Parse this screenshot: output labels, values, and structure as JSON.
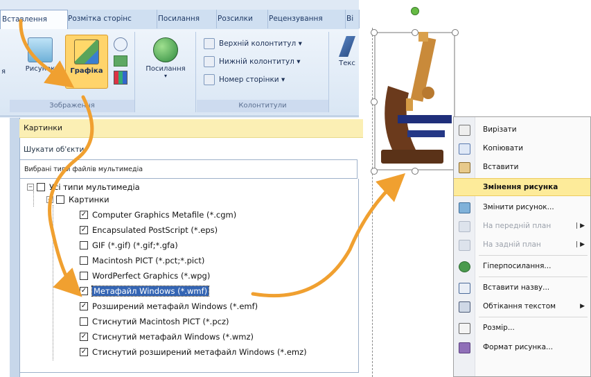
{
  "ribbon": {
    "tabs": [
      "Вставлення",
      "Розмітка сторінс",
      "Посилання",
      "Розсилки",
      "Рецензування",
      "Ві"
    ],
    "active_tab": 0,
    "left_cut_label": "я",
    "illustrations": {
      "picture": "Рисунок",
      "graphics": "Графіка",
      "group_label": "Зображення"
    },
    "links": {
      "button": "Посилання"
    },
    "headers": {
      "header": "Верхній колонтитул",
      "footer": "Нижній колонтитул",
      "page_number": "Номер сторінки",
      "group_label": "Колонтитули"
    },
    "text_cut_label": "Текс"
  },
  "clipart_pane": {
    "title": "Картинки",
    "search_label": "Шукати об'єкти:",
    "media_types_label": "Вибрані типи файлів мультимедіа",
    "tree": [
      {
        "label": "Усі типи мультимедіа",
        "level": 0,
        "checked": false,
        "expander": "−"
      },
      {
        "label": "Картинки",
        "level": 1,
        "checked": false,
        "expander": "−"
      },
      {
        "label": "Computer Graphics Metafile (*.cgm)",
        "level": 2,
        "checked": true
      },
      {
        "label": "Encapsulated PostScript (*.eps)",
        "level": 2,
        "checked": true
      },
      {
        "label": "GIF (*.gif) (*.gif;*.gfa)",
        "level": 2,
        "checked": false
      },
      {
        "label": "Macintosh PICT (*.pct;*.pict)",
        "level": 2,
        "checked": false
      },
      {
        "label": "WordPerfect Graphics (*.wpg)",
        "level": 2,
        "checked": false
      },
      {
        "label": "Метафайл Windows (*.wmf)",
        "level": 2,
        "checked": true,
        "selected": true
      },
      {
        "label": "Розширений метафайл Windows (*.emf)",
        "level": 2,
        "checked": true
      },
      {
        "label": "Стиснутий Macintosh PICT (*.pcz)",
        "level": 2,
        "checked": false
      },
      {
        "label": "Стиснутий метафайл Windows (*.wmz)",
        "level": 2,
        "checked": true
      },
      {
        "label": "Стиснутий розширений метафайл Windows (*.emz)",
        "level": 2,
        "checked": true
      }
    ]
  },
  "context_menu": {
    "items": [
      {
        "label": "Вирізати",
        "icon": "scissors-icon"
      },
      {
        "label": "Копіювати",
        "icon": "copy-icon"
      },
      {
        "label": "Вставити",
        "icon": "paste-icon"
      },
      {
        "label": "Змінення рисунка",
        "highlight": true
      },
      {
        "label": "Змінити рисунок...",
        "icon": "change-picture-icon"
      },
      {
        "label": "На передній план",
        "icon": "bring-forward-icon",
        "disabled": true,
        "submenu": true
      },
      {
        "label": "На задній план",
        "icon": "send-backward-icon",
        "disabled": true,
        "submenu": true
      },
      {
        "label": "Гіперпосилання...",
        "icon": "hyperlink-icon"
      },
      {
        "label": "Вставити назву...",
        "icon": "caption-icon"
      },
      {
        "label": "Обтікання текстом",
        "icon": "text-wrap-icon",
        "submenu": true
      },
      {
        "label": "Розмір...",
        "icon": "size-icon"
      },
      {
        "label": "Формат рисунка...",
        "icon": "format-picture-icon"
      }
    ],
    "submenu_glyph": "▶",
    "divider_glyph": "|"
  },
  "colors": {
    "accent_arrow": "#f0a030",
    "selection": "#3465b4",
    "highlight": "#fdeb9a",
    "pane_title": "#fbefb4"
  }
}
